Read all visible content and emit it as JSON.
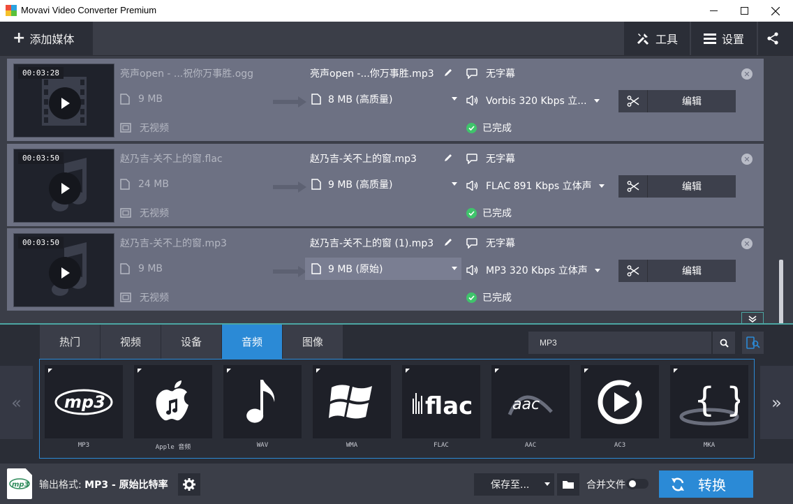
{
  "window": {
    "title": "Movavi Video Converter Premium"
  },
  "toolbar": {
    "add_media_label": "添加媒体",
    "tools_label": "工具",
    "settings_label": "设置"
  },
  "files": [
    {
      "duration": "00:03:28",
      "source_name": "亮声open - ...祝你万事胜.ogg",
      "source_size": "9 MB",
      "source_video": "无视频",
      "output_name": "亮声open -...你万事胜.mp3",
      "output_size": "8 MB (高质量)",
      "subtitles": "无字幕",
      "audio": "Vorbis 320 Kbps 立...",
      "status": "已完成",
      "edit_label": "编辑",
      "thumb_kind": "video"
    },
    {
      "duration": "00:03:50",
      "source_name": "赵乃吉-关不上的窗.flac",
      "source_size": "24 MB",
      "source_video": "无视频",
      "output_name": "赵乃吉-关不上的窗.mp3",
      "output_size": "9 MB (高质量)",
      "subtitles": "无字幕",
      "audio": "FLAC 891 Kbps 立体声",
      "status": "已完成",
      "edit_label": "编辑",
      "thumb_kind": "audio"
    },
    {
      "duration": "00:03:50",
      "source_name": "赵乃吉-关不上的窗.mp3",
      "source_size": "9 MB",
      "source_video": "无视频",
      "output_name": "赵乃吉-关不上的窗 (1).mp3",
      "output_size": "9 MB (原始)",
      "subtitles": "无字幕",
      "audio": "MP3 320 Kbps 立体声",
      "status": "已完成",
      "edit_label": "编辑",
      "thumb_kind": "audio"
    }
  ],
  "format_tabs": [
    "热门",
    "视频",
    "设备",
    "音频",
    "图像"
  ],
  "active_tab": "音频",
  "search": {
    "value": "MP3"
  },
  "presets": [
    {
      "label": "MP3",
      "icon": "mp3-logo-icon"
    },
    {
      "label": "Apple 音频",
      "icon": "apple-music-icon"
    },
    {
      "label": "WAV",
      "icon": "music-note-icon"
    },
    {
      "label": "WMA",
      "icon": "windows-logo-icon"
    },
    {
      "label": "FLAC",
      "icon": "flac-logo-icon"
    },
    {
      "label": "AAC",
      "icon": "aac-logo-icon"
    },
    {
      "label": "AC3",
      "icon": "ac3-play-icon"
    },
    {
      "label": "MKA",
      "icon": "mka-braces-icon"
    }
  ],
  "bottom": {
    "output_prefix": "输出格式: ",
    "output_format": "MP3 - 原始比特率",
    "save_to_label": "保存至...",
    "merge_label": "合并文件",
    "convert_label": "转换"
  },
  "colors": {
    "accent": "#2b8ad6",
    "success": "#3fc46b",
    "row_bg": "#6d7183"
  }
}
